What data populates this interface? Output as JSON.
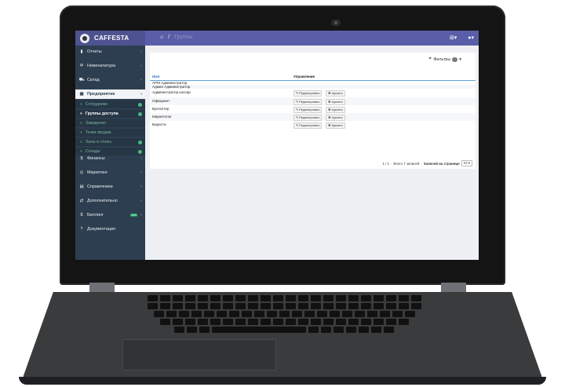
{
  "app": {
    "title": "CAFFESTA",
    "breadcrumb": {
      "home_icon": "home-icon",
      "separator": "/",
      "current": "Группы"
    },
    "topbar_right": [
      "square-plus-icon",
      "user-icon"
    ]
  },
  "sidebar": {
    "items": [
      {
        "icon": "bar-chart-icon",
        "glyph": "▮",
        "label": "Отчеты",
        "chevron": "‹"
      },
      {
        "icon": "cutlery-icon",
        "glyph": "Ψ",
        "label": "Номенклатура",
        "chevron": "‹"
      },
      {
        "icon": "truck-icon",
        "glyph": "⛟",
        "label": "Склад",
        "chevron": "‹"
      },
      {
        "icon": "building-icon",
        "glyph": "▣",
        "label": "Предприятие",
        "chevron": "‹"
      },
      {
        "icon": "dollar-icon",
        "glyph": "$",
        "label": "Финансы",
        "chevron": "‹"
      },
      {
        "icon": "target-icon",
        "glyph": "◎",
        "label": "Маркетинг",
        "chevron": "‹"
      },
      {
        "icon": "book-icon",
        "glyph": "▤",
        "label": "Справочники",
        "chevron": "‹"
      },
      {
        "icon": "sliders-icon",
        "glyph": "⇄",
        "label": "Дополнительно",
        "chevron": "‹"
      },
      {
        "icon": "dollar-icon",
        "glyph": "$",
        "label": "Биллинг",
        "chevron": "‹",
        "badge": "new"
      },
      {
        "icon": "question-icon",
        "glyph": "?",
        "label": "Документация",
        "chevron": ""
      }
    ],
    "subitems": [
      {
        "label": "Сотрудники",
        "dot": true
      },
      {
        "label": "Группы доступа",
        "dot": true,
        "current": true
      },
      {
        "label": "Заведения",
        "dot": false
      },
      {
        "label": "Точки продаж",
        "dot": false
      },
      {
        "label": "Залы и столы",
        "dot": true
      },
      {
        "label": "Склады",
        "dot": true
      }
    ],
    "social": [
      {
        "icon": "telegram-icon",
        "color": "#2ca5e0"
      },
      {
        "icon": "viber-icon",
        "color": "#7360f2"
      },
      {
        "icon": "whatsapp-icon",
        "color": "#25d366"
      },
      {
        "icon": "skype-icon",
        "color": "#00aff0"
      }
    ]
  },
  "content": {
    "filters_label": "Фильтры",
    "columns": {
      "name": "Имя",
      "control": "Управление"
    },
    "rows": [
      {
        "name": "АРМ Администратор",
        "actions": false
      },
      {
        "name": "Админ Администратор",
        "actions": false
      },
      {
        "name": "Администратор кассир",
        "actions": true
      },
      {
        "name": "Официант",
        "actions": true
      },
      {
        "name": "Бухгалтер",
        "actions": true
      },
      {
        "name": "Маркетолог",
        "actions": true
      },
      {
        "name": "Бариста",
        "actions": true
      }
    ],
    "edit_label": "Редактировать",
    "delete_label": "Удалить",
    "pager": {
      "pages": "1 / 1",
      "total": "Всего 7 записей",
      "per_page_label": "Записей на странице",
      "per_page_value": "10"
    }
  },
  "colors": {
    "topbar": "#5a5ea8",
    "sidebar": "#2d3e50",
    "accent_link": "#3a78c4",
    "table_rule": "#5aa2d8"
  }
}
